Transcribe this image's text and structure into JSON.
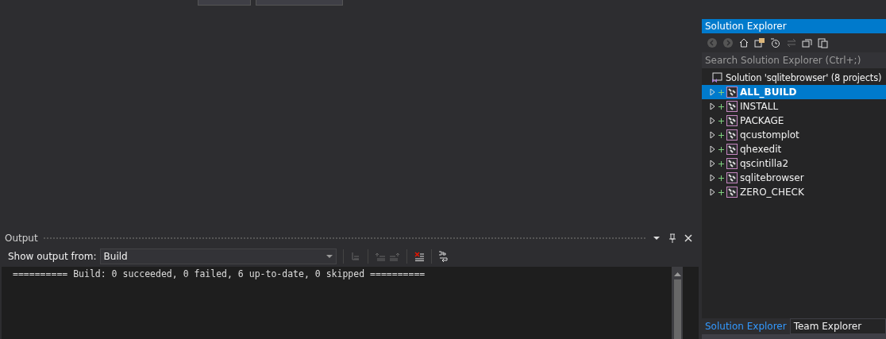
{
  "output": {
    "title": "Output",
    "show_label": "Show output from:",
    "source": "Build",
    "lines": [
      "========== Build: 0 succeeded, 0 failed, 6 up-to-date, 0 skipped =========="
    ]
  },
  "solution_explorer": {
    "title": "Solution Explorer",
    "search": {
      "placeholder": "Search Solution Explorer (Ctrl+;)"
    },
    "solution": "Solution 'sqlitebrowser' (8 projects)",
    "projects": [
      {
        "name": "ALL_BUILD",
        "selected": true
      },
      {
        "name": "INSTALL",
        "selected": false
      },
      {
        "name": "PACKAGE",
        "selected": false
      },
      {
        "name": "qcustomplot",
        "selected": false
      },
      {
        "name": "qhexedit",
        "selected": false
      },
      {
        "name": "qscintilla2",
        "selected": false
      },
      {
        "name": "sqlitebrowser",
        "selected": false
      },
      {
        "name": "ZERO_CHECK",
        "selected": false
      }
    ],
    "tabs": [
      {
        "label": "Solution Explorer",
        "selected": true
      },
      {
        "label": "Team Explorer",
        "selected": false
      }
    ]
  }
}
